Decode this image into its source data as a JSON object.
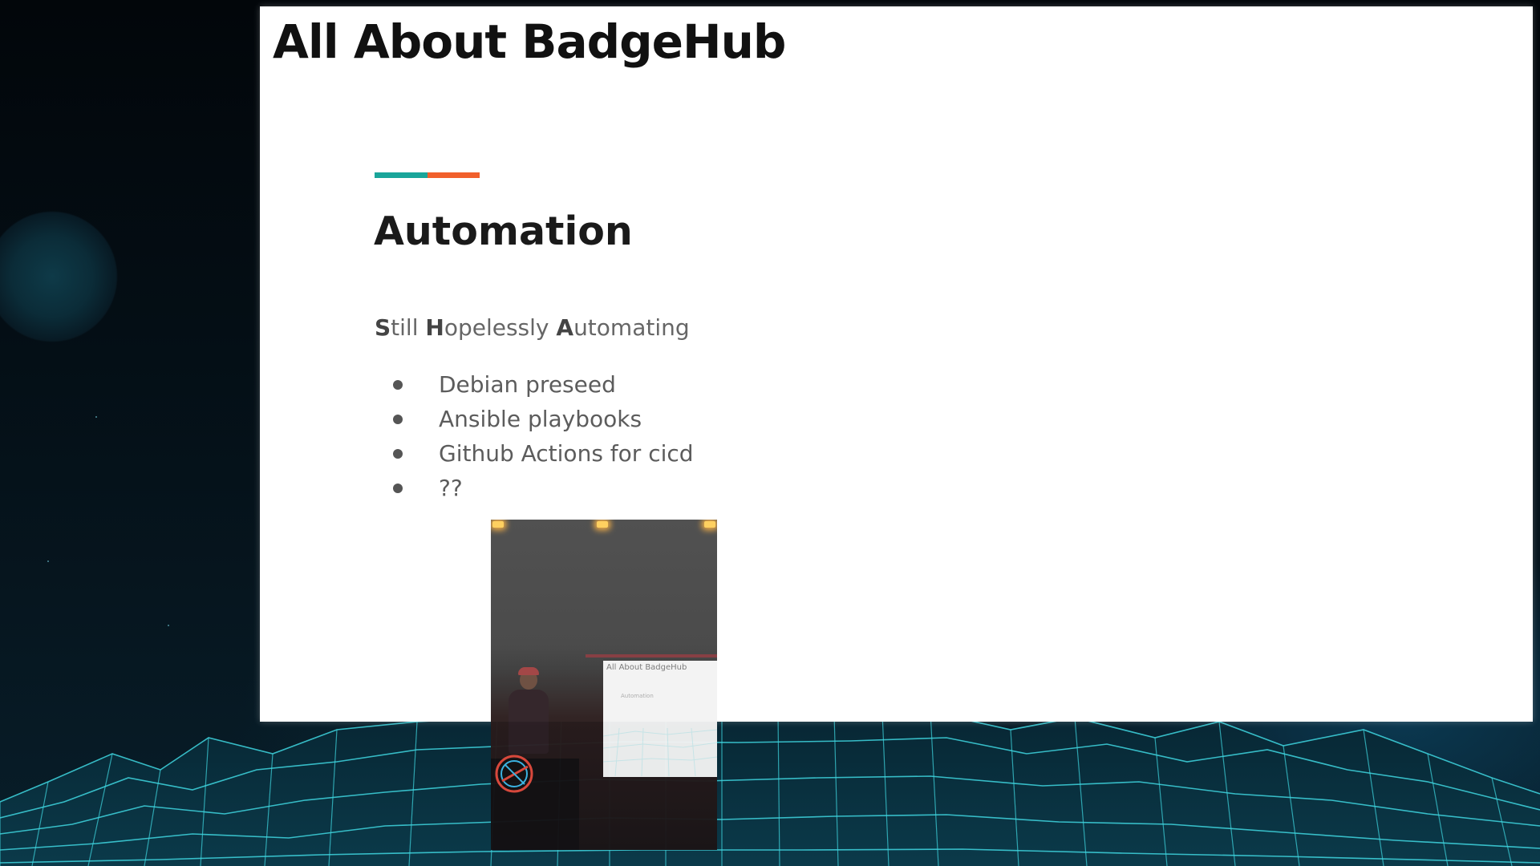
{
  "slide": {
    "header": "All About BadgeHub",
    "section_title": "Automation",
    "subtitle": {
      "letter1": "S",
      "rest1": "till ",
      "letter2": "H",
      "rest2": "opelessly ",
      "letter3": "A",
      "rest3": "utomating"
    },
    "bullets": [
      "Debian preseed",
      "Ansible playbooks",
      "Github Actions for cicd",
      "??"
    ],
    "accent_colors": {
      "teal": "#1aa59a",
      "orange": "#f1602c"
    }
  },
  "camera_inset": {
    "screen_title": "All About BadgeHub",
    "screen_subtitle": "Automation"
  },
  "background": {
    "grid_color": "#3fd6e0",
    "icons": [
      "planet-icon",
      "wireframe-terrain"
    ]
  }
}
